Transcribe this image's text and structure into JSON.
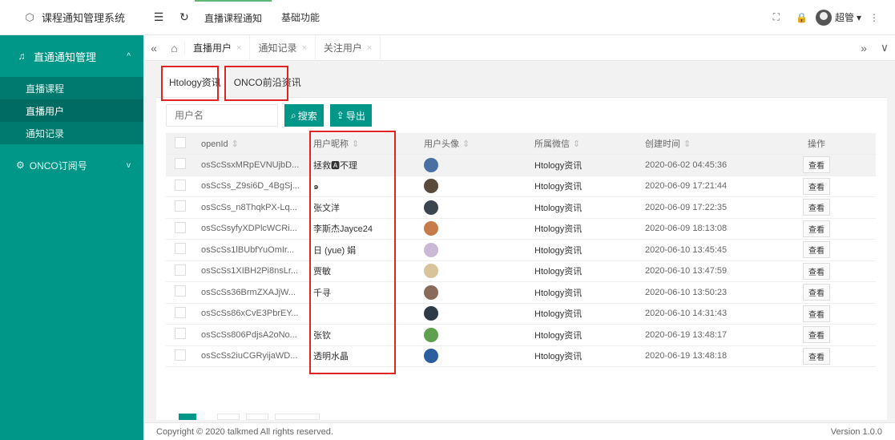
{
  "app": {
    "title": "课程通知管理系统"
  },
  "sidebar": {
    "group1": {
      "label": "直通通知管理"
    },
    "items": [
      {
        "label": "直播课程"
      },
      {
        "label": "直播用户"
      },
      {
        "label": "通知记录"
      }
    ],
    "group2": {
      "label": "ONCO订阅号"
    }
  },
  "topbar": {
    "links": [
      {
        "label": "直播课程通知"
      },
      {
        "label": "基础功能"
      }
    ],
    "user": "超管"
  },
  "page_tabs": [
    {
      "label": "直播用户"
    },
    {
      "label": "通知记录"
    },
    {
      "label": "关注用户"
    }
  ],
  "inner_tabs": [
    {
      "label": "Htology资讯"
    },
    {
      "label": "ONCO前沿资讯"
    }
  ],
  "search": {
    "placeholder": "用户名",
    "search_label": "搜索",
    "export_label": "导出"
  },
  "table": {
    "headers": [
      "openId",
      "用户昵称",
      "用户头像",
      "所属微信",
      "创建时间",
      "操作"
    ],
    "rows": [
      {
        "openid": "osScSsxMRpEVNUjbD...",
        "nick": "拯救🅰不理",
        "wx": "Htology资讯",
        "time": "2020-06-02 04:45:36",
        "op": "查看",
        "ava": "#4a6fa5"
      },
      {
        "openid": "osScSs_Z9si6D_4BgSj...",
        "nick": "๑",
        "wx": "Htology资讯",
        "time": "2020-06-09 17:21:44",
        "op": "查看",
        "ava": "#5a4a3a"
      },
      {
        "openid": "osScSs_n8ThqkPX-Lq...",
        "nick": "张文洋",
        "wx": "Htology资讯",
        "time": "2020-06-09 17:22:35",
        "op": "查看",
        "ava": "#3b4550"
      },
      {
        "openid": "osScSsyfyXDPlcWCRi...",
        "nick": "李斯杰Jayce24",
        "wx": "Htology资讯",
        "time": "2020-06-09 18:13:08",
        "op": "查看",
        "ava": "#c77a4a"
      },
      {
        "openid": "osScSs1lBUbfYuOmIr...",
        "nick": "日 (yue) 娟",
        "wx": "Htology资讯",
        "time": "2020-06-10 13:45:45",
        "op": "查看",
        "ava": "#c9b8d6"
      },
      {
        "openid": "osScSs1XIBH2Pi8nsLr...",
        "nick": "贾敏",
        "wx": "Htology资讯",
        "time": "2020-06-10 13:47:59",
        "op": "查看",
        "ava": "#d8c49a"
      },
      {
        "openid": "osScSs36BrmZXAJjW...",
        "nick": "千寻",
        "wx": "Htology资讯",
        "time": "2020-06-10 13:50:23",
        "op": "查看",
        "ava": "#8a6a5a"
      },
      {
        "openid": "osScSs86xCvE3PbrEY...",
        "nick": "",
        "wx": "Htology资讯",
        "time": "2020-06-10 14:31:43",
        "op": "查看",
        "ava": "#2e3a48"
      },
      {
        "openid": "osScSs806PdjsA2oNo...",
        "nick": "张钦",
        "wx": "Htology资讯",
        "time": "2020-06-19 13:48:17",
        "op": "查看",
        "ava": "#5fa04e"
      },
      {
        "openid": "osScSs2iuCGRyijaWD...",
        "nick": "透明水晶",
        "wx": "Htology资讯",
        "time": "2020-06-19 13:48:18",
        "op": "查看",
        "ava": "#2b5e9e"
      }
    ]
  },
  "footer": {
    "copyright": "Copyright © 2020 talkmed All rights reserved.",
    "version": "Version 1.0.0"
  }
}
